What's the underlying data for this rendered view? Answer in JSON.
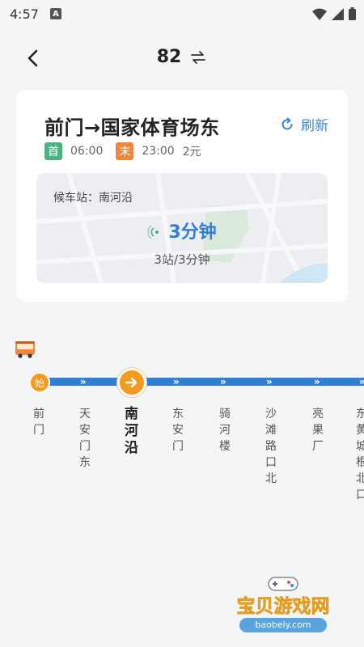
{
  "status_bar": {
    "time": "4:57",
    "app_badge": "A"
  },
  "header": {
    "route_number": "82"
  },
  "card": {
    "title": "前门→国家体育场东",
    "refresh_label": "刷新",
    "first_tag": "首",
    "first_time": "06:00",
    "last_tag": "末",
    "last_time": "23:00",
    "fare": "2元",
    "waiting_station": "候车站：南河沿",
    "eta": "3分钟",
    "eta_detail": "3站/3分钟"
  },
  "route": {
    "start_marker": "始",
    "stops": [
      {
        "name": "前门"
      },
      {
        "name": "天安门东"
      },
      {
        "name": "南河沿"
      },
      {
        "name": "东安门"
      },
      {
        "name": "骑河楼"
      },
      {
        "name": "沙滩路口北"
      },
      {
        "name": "亮果厂"
      },
      {
        "name": "东黄城根北口"
      }
    ]
  },
  "watermark": {
    "text": "宝贝游戏网",
    "url": "baobeiy.com"
  },
  "colors": {
    "accent": "#2f7fd6",
    "orange": "#f39a1f",
    "green": "#47b37e",
    "last": "#f0853c"
  }
}
